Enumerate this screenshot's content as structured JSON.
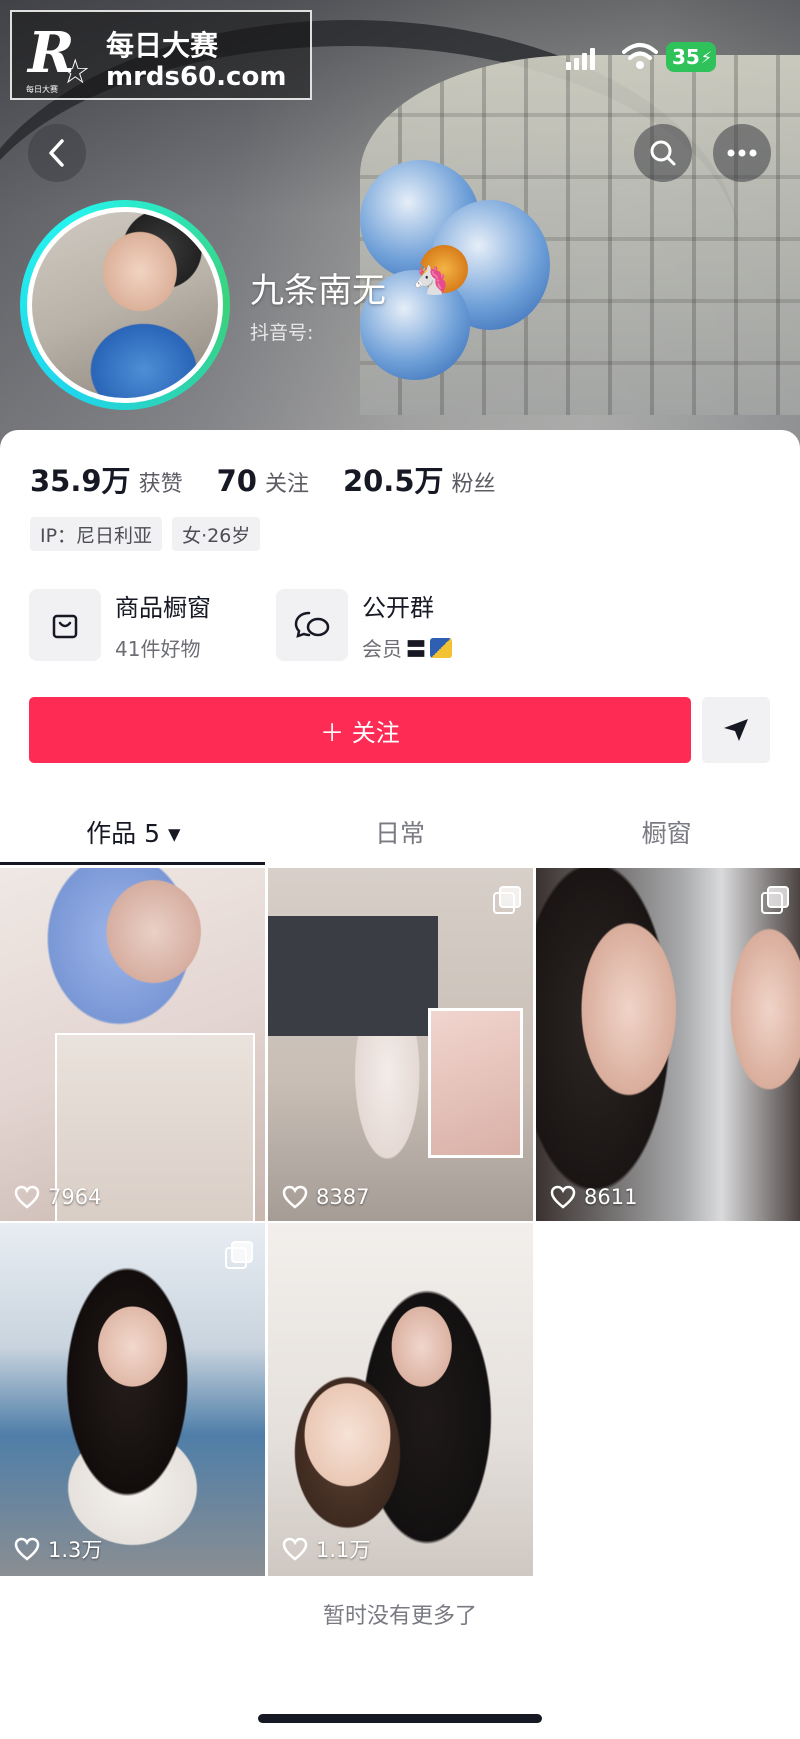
{
  "watermark": {
    "brand_line1": "每日大赛",
    "brand_line2": "mrds60.com",
    "logo_letter": "R",
    "logo_small": "每日大赛"
  },
  "status_bar": {
    "battery": "35"
  },
  "profile": {
    "name": "九条南无",
    "handle_label": "抖音号:"
  },
  "stats": [
    {
      "value": "35.9万",
      "label": "获赞"
    },
    {
      "value": "70",
      "label": "关注"
    },
    {
      "value": "20.5万",
      "label": "粉丝"
    }
  ],
  "tags": [
    "IP：尼日利亚",
    "女·26岁"
  ],
  "features": {
    "shop": {
      "title": "商品橱窗",
      "subtitle": "41件好物"
    },
    "group": {
      "title": "公开群",
      "subtitle": "会员"
    }
  },
  "actions": {
    "follow_label": "＋ 关注"
  },
  "tabs": [
    {
      "label": "作品 5 ▾",
      "active": true
    },
    {
      "label": "日常",
      "active": false
    },
    {
      "label": "橱窗",
      "active": false
    }
  ],
  "posts": [
    {
      "likes": "7964",
      "multi": false
    },
    {
      "likes": "8387",
      "multi": true
    },
    {
      "likes": "8611",
      "multi": true
    },
    {
      "likes": "1.3万",
      "multi": true
    },
    {
      "likes": "1.1万",
      "multi": false
    }
  ],
  "footer": {
    "no_more": "暂时没有更多了"
  },
  "colors": {
    "accent": "#fe2c55",
    "avatar_ring": "#20d5ec",
    "battery": "#2fc25b"
  }
}
